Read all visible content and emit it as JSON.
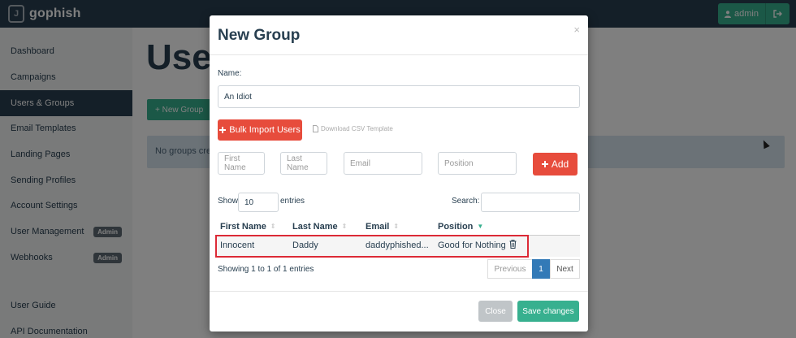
{
  "navbar": {
    "brand": "gophish",
    "brand_icon": "gophish-logo-icon",
    "admin_label": "admin",
    "admin_icon": "user-icon",
    "logout_icon": "sign-out-icon"
  },
  "sidebar": {
    "items": [
      {
        "label": "Dashboard"
      },
      {
        "label": "Campaigns"
      },
      {
        "label": "Users & Groups",
        "active": true
      },
      {
        "label": "Email Templates"
      },
      {
        "label": "Landing Pages"
      },
      {
        "label": "Sending Profiles"
      },
      {
        "label": "Account Settings"
      },
      {
        "label": "User Management",
        "badge": "Admin"
      },
      {
        "label": "Webhooks",
        "badge": "Admin"
      },
      {
        "label": "User Guide"
      },
      {
        "label": "API Documentation"
      }
    ]
  },
  "main": {
    "page_title": "Users",
    "new_group_label": "+ New Group",
    "alert_text": "No groups created yet. Let's create one!"
  },
  "modal": {
    "title": "New Group",
    "close_symbol": "×",
    "name_label": "Name:",
    "name_value": "An Idiot",
    "bulk_import_label": "Bulk Import Users",
    "download_csv_label": "Download CSV Template",
    "first_name_placeholder": "First Name",
    "last_name_placeholder": "Last Name",
    "email_placeholder": "Email",
    "position_placeholder": "Position",
    "add_label": "Add",
    "show_label": "Show",
    "entries_value": "10",
    "entries_label": "entries",
    "search_label": "Search:",
    "columns": [
      "First Name",
      "Last Name",
      "Email",
      "Position"
    ],
    "rows": [
      {
        "first_name": "Innocent",
        "last_name": "Daddy",
        "email": "daddyphished...",
        "position": "Good for Nothing"
      }
    ],
    "showing_text": "Showing 1 to 1 of 1 entries",
    "pager": {
      "previous": "Previous",
      "page": "1",
      "next": "Next"
    },
    "close_label": "Close",
    "save_label": "Save changes"
  },
  "colors": {
    "navbar": "#283f50",
    "accent_green": "#37b08f",
    "danger_red": "#e74c3c",
    "highlight_red": "#dc2a36",
    "pager_blue": "#337ab7"
  }
}
